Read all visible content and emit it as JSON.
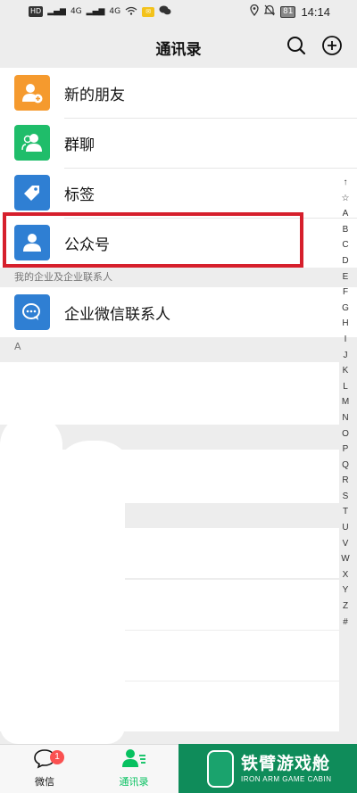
{
  "status": {
    "hd": "HD",
    "net1": "4G",
    "net2": "4G",
    "battery": "81",
    "time": "14:14"
  },
  "header": {
    "title": "通讯录"
  },
  "list": {
    "items": [
      {
        "label": "新的朋友",
        "icon": "add-friend-icon",
        "color": "#f59a2e"
      },
      {
        "label": "群聊",
        "icon": "group-chat-icon",
        "color": "#1fbd6a"
      },
      {
        "label": "标签",
        "icon": "tag-icon",
        "color": "#2f7fd3"
      },
      {
        "label": "公众号",
        "icon": "official-account-icon",
        "color": "#2f7fd3"
      }
    ],
    "enterprise_header": "我的企业及企业联系人",
    "enterprise_item": {
      "label": "企业微信联系人",
      "icon": "enterprise-contacts-icon",
      "color": "#2f7fd3"
    },
    "contacts_header": "A"
  },
  "alpha_index": [
    "↑",
    "☆",
    "A",
    "B",
    "C",
    "D",
    "E",
    "F",
    "G",
    "H",
    "I",
    "J",
    "K",
    "L",
    "M",
    "N",
    "O",
    "P",
    "Q",
    "R",
    "S",
    "T",
    "U",
    "V",
    "W",
    "X",
    "Y",
    "Z",
    "#"
  ],
  "bottom_nav": {
    "tabs": [
      {
        "label": "微信",
        "badge": "1",
        "icon": "chat-icon",
        "active": false
      },
      {
        "label": "通讯录",
        "icon": "contacts-icon",
        "active": true
      }
    ]
  },
  "watermark": {
    "cn": "铁臂游戏舱",
    "en": "IRON ARM GAME CABIN"
  },
  "colors": {
    "accent": "#07c160",
    "highlight": "#d61f2c"
  }
}
